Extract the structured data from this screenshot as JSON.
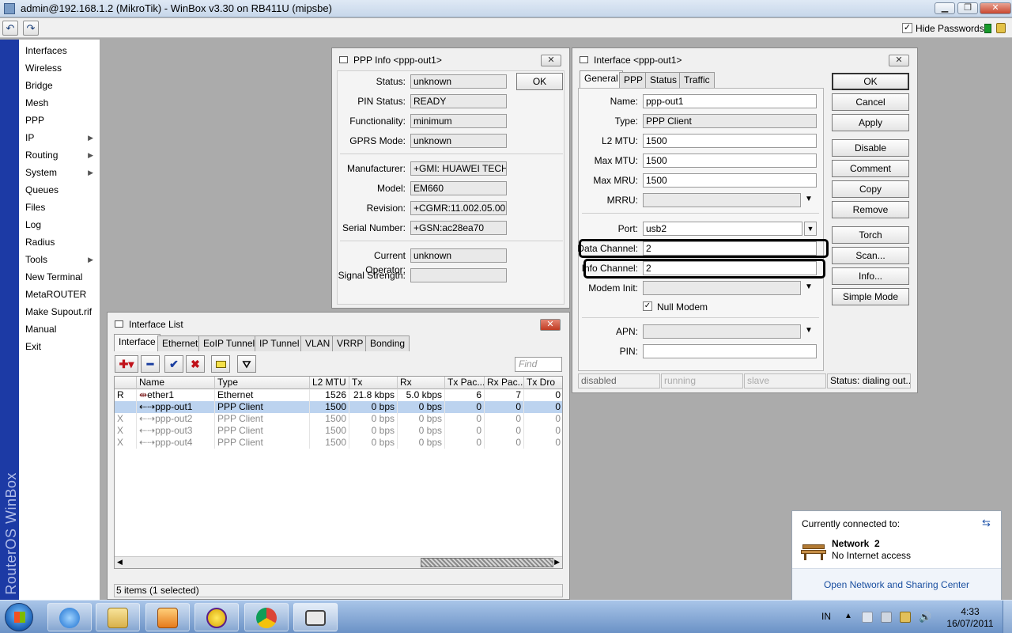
{
  "window": {
    "title": "admin@192.168.1.2 (MikroTik) - WinBox v3.30 on RB411U (mipsbe)"
  },
  "toolbar": {
    "hide_passwords_label": "Hide Passwords",
    "hide_passwords_checked": "✓"
  },
  "brand": "RouterOS WinBox",
  "sidebar": {
    "items": [
      {
        "label": "Interfaces"
      },
      {
        "label": "Wireless"
      },
      {
        "label": "Bridge"
      },
      {
        "label": "Mesh"
      },
      {
        "label": "PPP"
      },
      {
        "label": "IP",
        "arrow": "▶"
      },
      {
        "label": "Routing",
        "arrow": "▶"
      },
      {
        "label": "System",
        "arrow": "▶"
      },
      {
        "label": "Queues"
      },
      {
        "label": "Files"
      },
      {
        "label": "Log"
      },
      {
        "label": "Radius"
      },
      {
        "label": "Tools",
        "arrow": "▶"
      },
      {
        "label": "New Terminal"
      },
      {
        "label": "MetaROUTER"
      },
      {
        "label": "Make Supout.rif"
      },
      {
        "label": "Manual"
      },
      {
        "label": "Exit"
      }
    ]
  },
  "ppp_info": {
    "title": "PPP Info <ppp-out1>",
    "ok_label": "OK",
    "fields": [
      {
        "label": "Status:",
        "value": "unknown"
      },
      {
        "label": "PIN Status:",
        "value": "READY"
      },
      {
        "label": "Functionality:",
        "value": "minimum"
      },
      {
        "label": "GPRS Mode:",
        "value": "unknown"
      },
      {
        "label": "Manufacturer:",
        "value": "+GMI: HUAWEI TECH..."
      },
      {
        "label": "Model:",
        "value": "EM660"
      },
      {
        "label": "Revision:",
        "value": "+CGMR:11.002.05.00...."
      },
      {
        "label": "Serial Number:",
        "value": "+GSN:ac28ea70"
      },
      {
        "label": "Current Operator:",
        "value": "unknown"
      },
      {
        "label": "Signal Strength:",
        "value": ""
      }
    ]
  },
  "iface_dialog": {
    "title": "Interface <ppp-out1>",
    "tabs": [
      "General",
      "PPP",
      "Status",
      "Traffic"
    ],
    "fields": {
      "name": {
        "label": "Name:",
        "value": "ppp-out1"
      },
      "type": {
        "label": "Type:",
        "value": "PPP Client"
      },
      "l2mtu": {
        "label": "L2 MTU:",
        "value": "1500"
      },
      "max_mtu": {
        "label": "Max MTU:",
        "value": "1500"
      },
      "max_mru": {
        "label": "Max MRU:",
        "value": "1500"
      },
      "mrru": {
        "label": "MRRU:",
        "value": ""
      },
      "port": {
        "label": "Port:",
        "value": "usb2"
      },
      "data_channel": {
        "label": "Data Channel:",
        "value": "2"
      },
      "info_channel": {
        "label": "Info Channel:",
        "value": "2"
      },
      "modem_init": {
        "label": "Modem Init:",
        "value": ""
      },
      "null_modem": {
        "label": "Null Modem",
        "checked": "✓"
      },
      "apn": {
        "label": "APN:",
        "value": ""
      },
      "pin": {
        "label": "PIN:",
        "value": ""
      }
    },
    "buttons": [
      "OK",
      "Cancel",
      "Apply",
      "Disable",
      "Comment",
      "Copy",
      "Remove",
      "Torch",
      "Scan...",
      "Info...",
      "Simple Mode"
    ],
    "statusbar": {
      "s1": "disabled",
      "s2": "running",
      "s3": "slave",
      "s4": "Status: dialing out..."
    }
  },
  "iface_list": {
    "title": "Interface List",
    "tabs": [
      "Interface",
      "Ethernet",
      "EoIP Tunnel",
      "IP Tunnel",
      "VLAN",
      "VRRP",
      "Bonding"
    ],
    "find_placeholder": "Find",
    "columns": [
      "Name",
      "Type",
      "L2 MTU",
      "Tx",
      "Rx",
      "Tx Pac...",
      "Rx Pac...",
      "Tx Dro"
    ],
    "rows": [
      {
        "flag": "R",
        "name": "ether1",
        "type": "Ethernet",
        "l2mtu": "1526",
        "tx": "21.8 kbps",
        "rx": "5.0 kbps",
        "txp": "6",
        "rxp": "7",
        "txd": "0"
      },
      {
        "flag": "",
        "name": "ppp-out1",
        "type": "PPP Client",
        "l2mtu": "1500",
        "tx": "0 bps",
        "rx": "0 bps",
        "txp": "0",
        "rxp": "0",
        "txd": "0"
      },
      {
        "flag": "X",
        "name": "ppp-out2",
        "type": "PPP Client",
        "l2mtu": "1500",
        "tx": "0 bps",
        "rx": "0 bps",
        "txp": "0",
        "rxp": "0",
        "txd": "0"
      },
      {
        "flag": "X",
        "name": "ppp-out3",
        "type": "PPP Client",
        "l2mtu": "1500",
        "tx": "0 bps",
        "rx": "0 bps",
        "txp": "0",
        "rxp": "0",
        "txd": "0"
      },
      {
        "flag": "X",
        "name": "ppp-out4",
        "type": "PPP Client",
        "l2mtu": "1500",
        "tx": "0 bps",
        "rx": "0 bps",
        "txp": "0",
        "rxp": "0",
        "txd": "0"
      }
    ],
    "status": "5 items (1 selected)"
  },
  "network_popup": {
    "heading": "Currently connected to:",
    "network_name": "Network  2",
    "network_status": "No Internet access",
    "link": "Open Network and Sharing Center"
  },
  "taskbar": {
    "ime": "IN",
    "time": "4:33",
    "date": "16/07/2011"
  }
}
